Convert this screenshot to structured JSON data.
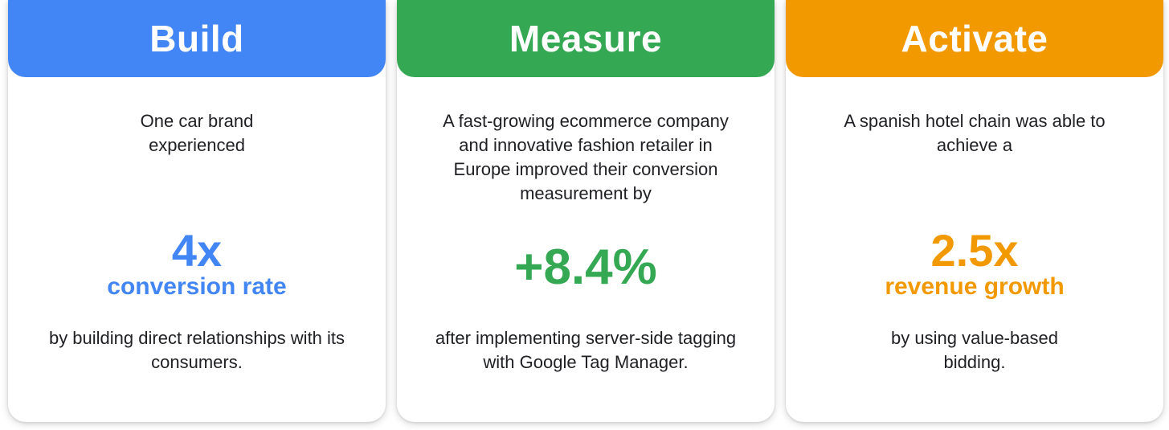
{
  "colors": {
    "build": "#4285F4",
    "measure": "#34A853",
    "activate": "#F29900",
    "text": "#202124"
  },
  "cards": [
    {
      "title": "Build",
      "intro": "One car brand experienced",
      "stat_value": "4x",
      "stat_label": "conversion rate",
      "outro": "by building direct relationships with its consumers."
    },
    {
      "title": "Measure",
      "intro": "A fast-growing ecommerce company and innovative fashion retailer in Europe improved their conversion measurement by",
      "stat_value": "+8.4%",
      "stat_label": "",
      "outro": "after implementing server-side tagging with Google Tag Manager."
    },
    {
      "title": "Activate",
      "intro": "A spanish hotel chain was able to achieve a",
      "stat_value": "2.5x",
      "stat_label": "revenue growth",
      "outro": "by using value-based bidding."
    }
  ]
}
